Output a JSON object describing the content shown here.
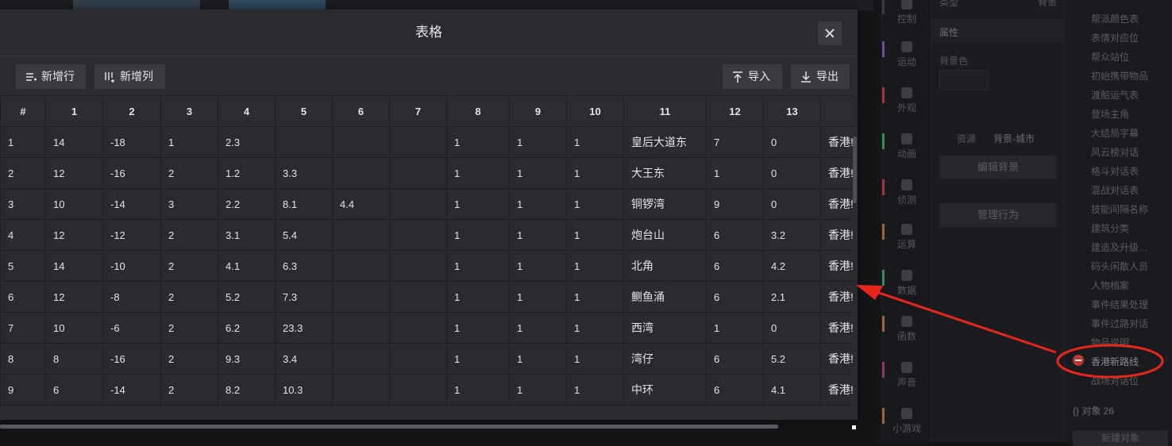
{
  "modal": {
    "title": "表格",
    "toolbar": {
      "add_row": "新增行",
      "add_col": "新增列",
      "import": "导入",
      "export": "导出"
    },
    "columns": [
      "#",
      "1",
      "2",
      "3",
      "4",
      "5",
      "6",
      "7",
      "8",
      "9",
      "10",
      "11",
      "12",
      "13",
      ""
    ],
    "rows": [
      [
        "1",
        "14",
        "-18",
        "1",
        "2.3",
        "",
        "",
        "",
        "1",
        "1",
        "1",
        "皇后大道东",
        "7",
        "0",
        "香港!"
      ],
      [
        "2",
        "12",
        "-16",
        "2",
        "1.2",
        "3.3",
        "",
        "",
        "1",
        "1",
        "1",
        "大王东",
        "1",
        "0",
        "香港!"
      ],
      [
        "3",
        "10",
        "-14",
        "3",
        "2.2",
        "8.1",
        "4.4",
        "",
        "1",
        "1",
        "1",
        "铜锣湾",
        "9",
        "0",
        "香港!"
      ],
      [
        "4",
        "12",
        "-12",
        "2",
        "3.1",
        "5.4",
        "",
        "",
        "1",
        "1",
        "1",
        "炮台山",
        "6",
        "3.2",
        "香港!"
      ],
      [
        "5",
        "14",
        "-10",
        "2",
        "4.1",
        "6.3",
        "",
        "",
        "1",
        "1",
        "1",
        "北角",
        "6",
        "4.2",
        "香港!"
      ],
      [
        "6",
        "12",
        "-8",
        "2",
        "5.2",
        "7.3",
        "",
        "",
        "1",
        "1",
        "1",
        "鲗鱼涌",
        "6",
        "2.1",
        "香港!"
      ],
      [
        "7",
        "10",
        "-6",
        "2",
        "6.2",
        "23.3",
        "",
        "",
        "1",
        "1",
        "1",
        "西湾",
        "1",
        "0",
        "香港!"
      ],
      [
        "8",
        "8",
        "-16",
        "2",
        "9.3",
        "3.4",
        "",
        "",
        "1",
        "1",
        "1",
        "湾仔",
        "6",
        "5.2",
        "香港!"
      ],
      [
        "9",
        "6",
        "-14",
        "2",
        "8.2",
        "10.3",
        "",
        "",
        "1",
        "1",
        "1",
        "中环",
        "6",
        "4.1",
        "香港!"
      ]
    ]
  },
  "rail": [
    {
      "label": "控制",
      "color": "#3a3b40"
    },
    {
      "label": "运动",
      "color": "#6a4a9a"
    },
    {
      "label": "外观",
      "color": "#9a3a3a"
    },
    {
      "label": "动画",
      "color": "#3a8a4a"
    },
    {
      "label": "侦测",
      "color": "#9a3a3a"
    },
    {
      "label": "运算",
      "color": "#9a6a3a"
    },
    {
      "label": "数据",
      "color": "#3a8a5a"
    },
    {
      "label": "函数",
      "color": "#9a6a3a"
    },
    {
      "label": "声音",
      "color": "#8a3a6a"
    },
    {
      "label": "小游戏",
      "color": "#9a6a3a"
    }
  ],
  "props": {
    "type_label": "类型",
    "type_value": "背景",
    "attr_label": "属性",
    "bgcolor_label": "背景色",
    "resource_label": "资源",
    "resource_value": "背景-城市",
    "edit_bg": "编辑背景",
    "manage_behavior": "管理行为"
  },
  "list": {
    "items": [
      "帮派颜色表",
      "表情对应位",
      "帮众站位",
      "初始携带物品",
      "渡船运气表",
      "登场主角",
      "大结局字幕",
      "风云榜对话",
      "格斗对话表",
      "混战对话表",
      "技能间隔名称",
      "建筑分类",
      "建造及升级…",
      "码头闲散人员",
      "人物档案",
      "事件结果处理",
      "事件过路对话",
      "物品说明",
      "香港新路线",
      "战场对话位"
    ],
    "active_index": 18,
    "object_count": "{} 对象 26",
    "new_object": "新建对象"
  },
  "colors": {
    "annotation": "#e8261c",
    "modal_bg": "#2a2b2f",
    "accent_red": "#b83a32"
  }
}
